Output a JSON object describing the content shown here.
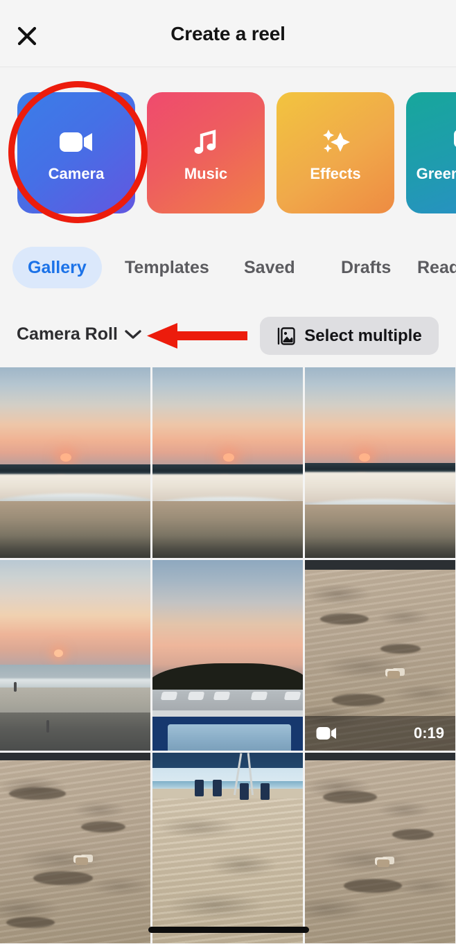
{
  "header": {
    "title": "Create a reel",
    "close_icon": "close-icon"
  },
  "shortcut_cards": [
    {
      "label": "Camera",
      "icon": "video-camera-icon",
      "color_start": "#3b7de8",
      "color_end": "#6257e0"
    },
    {
      "label": "Music",
      "icon": "music-note-icon",
      "color_start": "#ef4a6e",
      "color_end": "#f08047"
    },
    {
      "label": "Effects",
      "icon": "sparkles-icon",
      "color_start": "#f2c43f",
      "color_end": "#ee8b42"
    },
    {
      "label": "Green screen",
      "icon": "green-screen-icon",
      "color_start": "#17a79b",
      "color_end": "#2a8ec8"
    }
  ],
  "tabs": [
    {
      "label": "Gallery",
      "active": true
    },
    {
      "label": "Templates",
      "active": false
    },
    {
      "label": "Saved",
      "active": false
    },
    {
      "label": "Drafts",
      "active": false
    },
    {
      "label": "Ready",
      "active": false
    }
  ],
  "source_row": {
    "album_label": "Camera Roll",
    "album_chevron_icon": "chevron-down-icon",
    "select_multiple_label": "Select multiple",
    "select_multiple_icon": "photo-stack-icon"
  },
  "gallery": {
    "items": [
      {
        "kind": "photo",
        "scene": "sunset-close",
        "alt": "Sunset over ocean waves"
      },
      {
        "kind": "photo",
        "scene": "sunset-close",
        "alt": "Sunset over ocean waves"
      },
      {
        "kind": "photo",
        "scene": "sunset-close",
        "alt": "Sunset over ocean waves"
      },
      {
        "kind": "photo",
        "scene": "beach-wide",
        "alt": "Wide beach at sunset"
      },
      {
        "kind": "photo",
        "scene": "pool",
        "alt": "Swimming pool at dusk"
      },
      {
        "kind": "video",
        "scene": "sand",
        "alt": "Sand with footprints",
        "duration": "0:19",
        "video_icon": "video-camera-icon"
      },
      {
        "kind": "photo",
        "scene": "sand",
        "alt": "Sand with footprints"
      },
      {
        "kind": "photo",
        "scene": "sand-chairs",
        "alt": "Beach chairs on sand"
      },
      {
        "kind": "photo",
        "scene": "sand",
        "alt": "Sand with footprints"
      }
    ]
  },
  "annotations": {
    "circle_target": "Camera",
    "arrow_target": "Camera Roll",
    "color": "#ec1c0c"
  },
  "system": {
    "home_indicator": true
  }
}
